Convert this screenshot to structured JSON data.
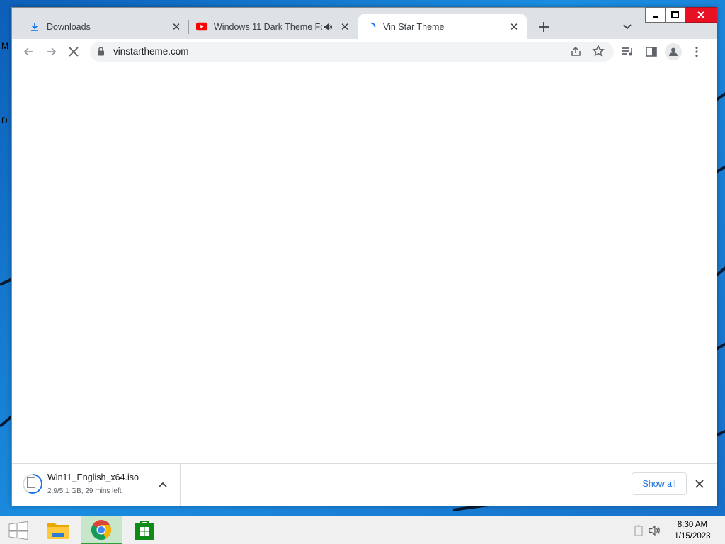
{
  "desktop": {
    "side_letters": [
      "M",
      "D"
    ]
  },
  "tabs": [
    {
      "title": "Downloads",
      "icon": "download-icon",
      "active": false
    },
    {
      "title": "Windows 11 Dark Theme For",
      "icon": "youtube-icon",
      "active": false,
      "audio": true
    },
    {
      "title": "Vin Star Theme",
      "icon": "loading-spinner-icon",
      "active": true
    }
  ],
  "toolbar": {
    "url": "vinstartheme.com"
  },
  "download": {
    "filename": "Win11_English_x64.iso",
    "status": "2.9/5.1 GB, 29 mins left",
    "progress_fraction": 0.57,
    "show_all_label": "Show all"
  },
  "taskbar": {
    "time": "8:30 AM",
    "date": "1/15/2023"
  },
  "colors": {
    "accent": "#1a73e8",
    "close_red": "#e81123",
    "tabstrip": "#dee1e6"
  }
}
